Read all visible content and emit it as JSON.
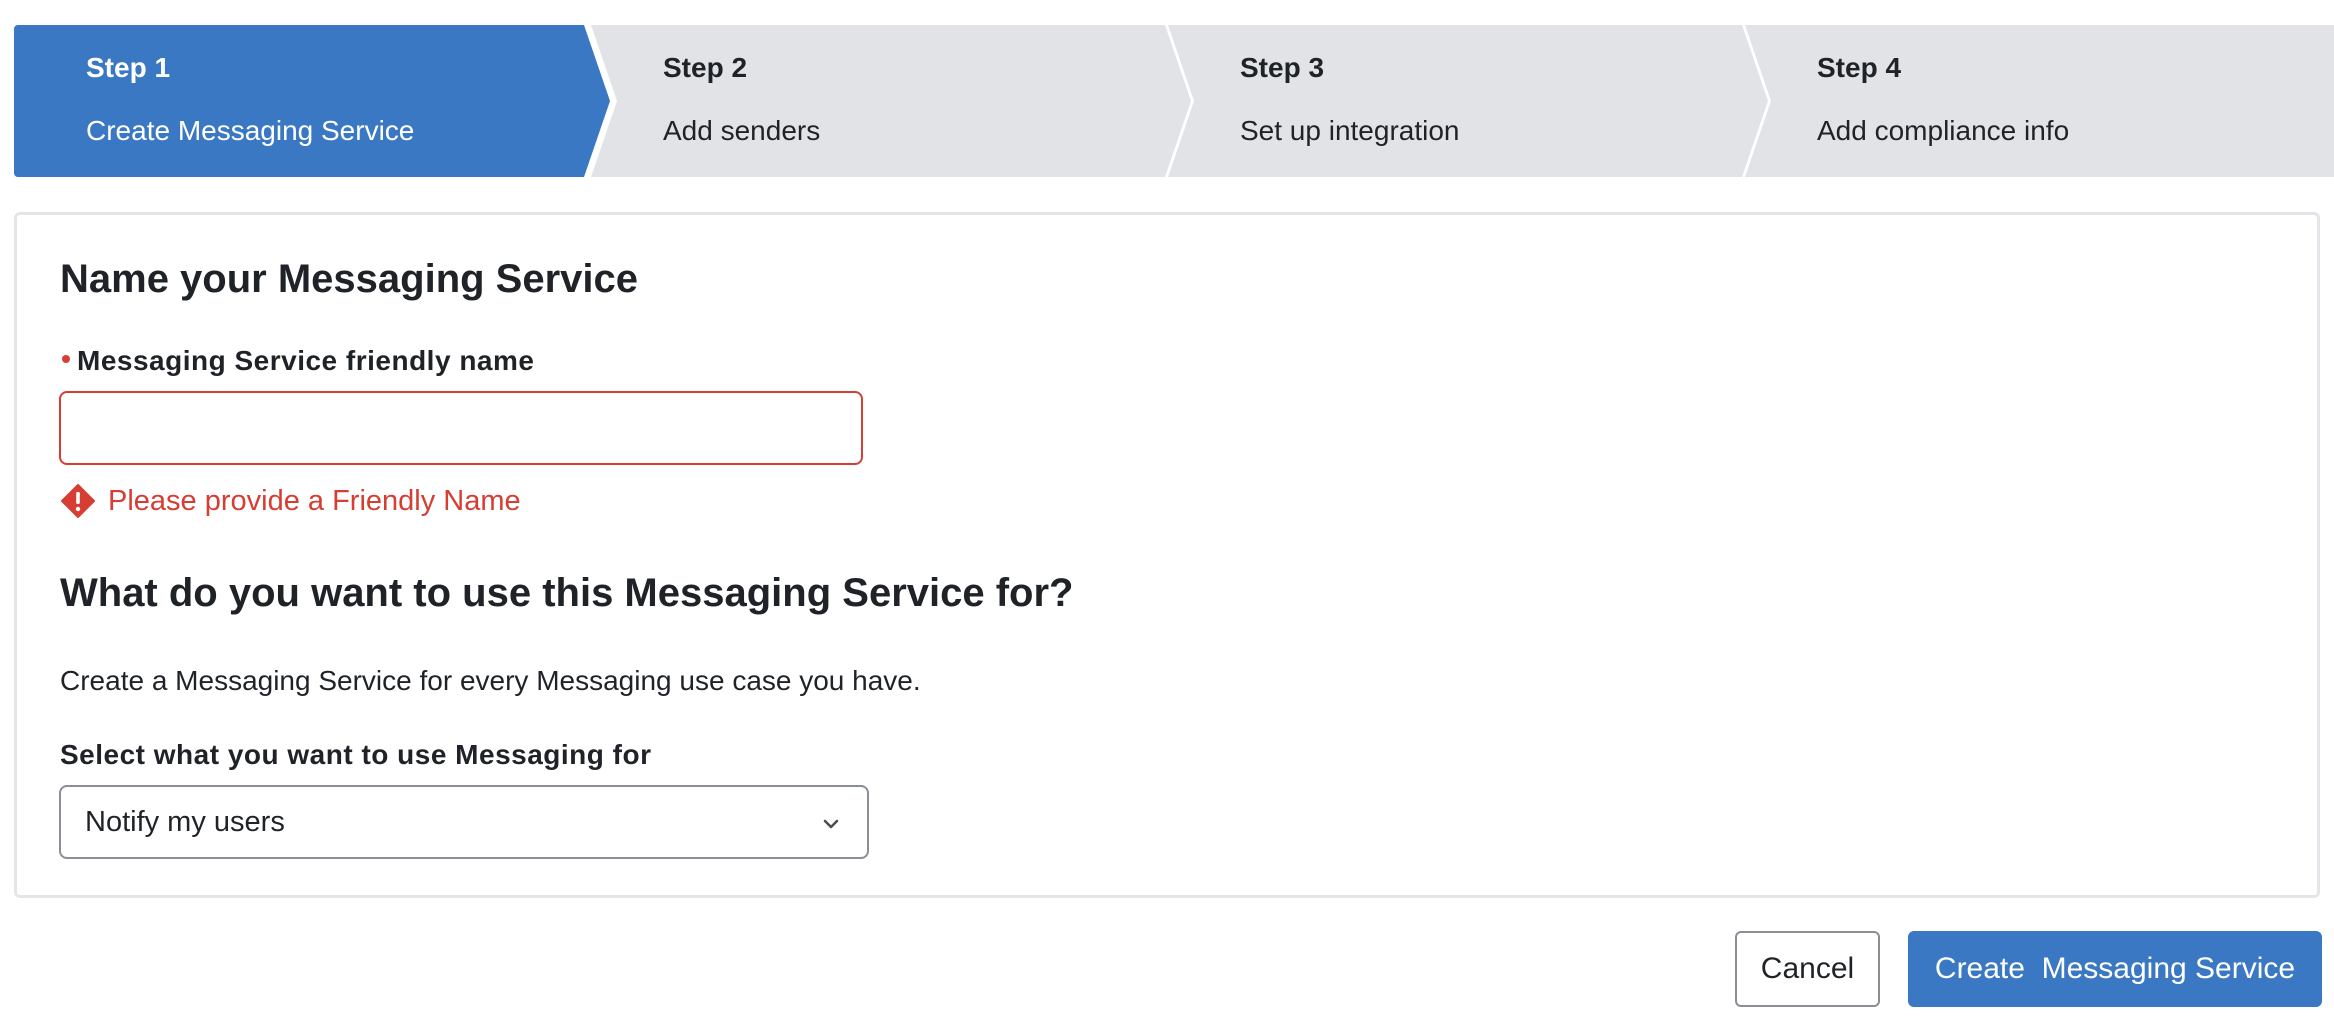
{
  "stepper": {
    "steps": [
      {
        "number": "Step 1",
        "label": "Create Messaging Service",
        "active": true
      },
      {
        "number": "Step 2",
        "label": "Add senders",
        "active": false
      },
      {
        "number": "Step 3",
        "label": "Set up integration",
        "active": false
      },
      {
        "number": "Step 4",
        "label": "Add compliance info",
        "active": false
      }
    ]
  },
  "form": {
    "section1_title": "Name your Messaging Service",
    "friendly_name_label": "Messaging Service friendly name",
    "friendly_name_value": "",
    "friendly_name_error": "Please provide a Friendly Name",
    "section2_title": "What do you want to use this Messaging Service for?",
    "section2_description": "Create a Messaging Service for every Messaging use case you have.",
    "use_label": "Select what you want to use Messaging for",
    "use_selected": "Notify my users"
  },
  "footer": {
    "cancel_label": "Cancel",
    "create_label": "Create  Messaging Service"
  },
  "colors": {
    "accent": "#3a78c4",
    "error": "#d63d33",
    "step_inactive": "#e1e3e6"
  }
}
